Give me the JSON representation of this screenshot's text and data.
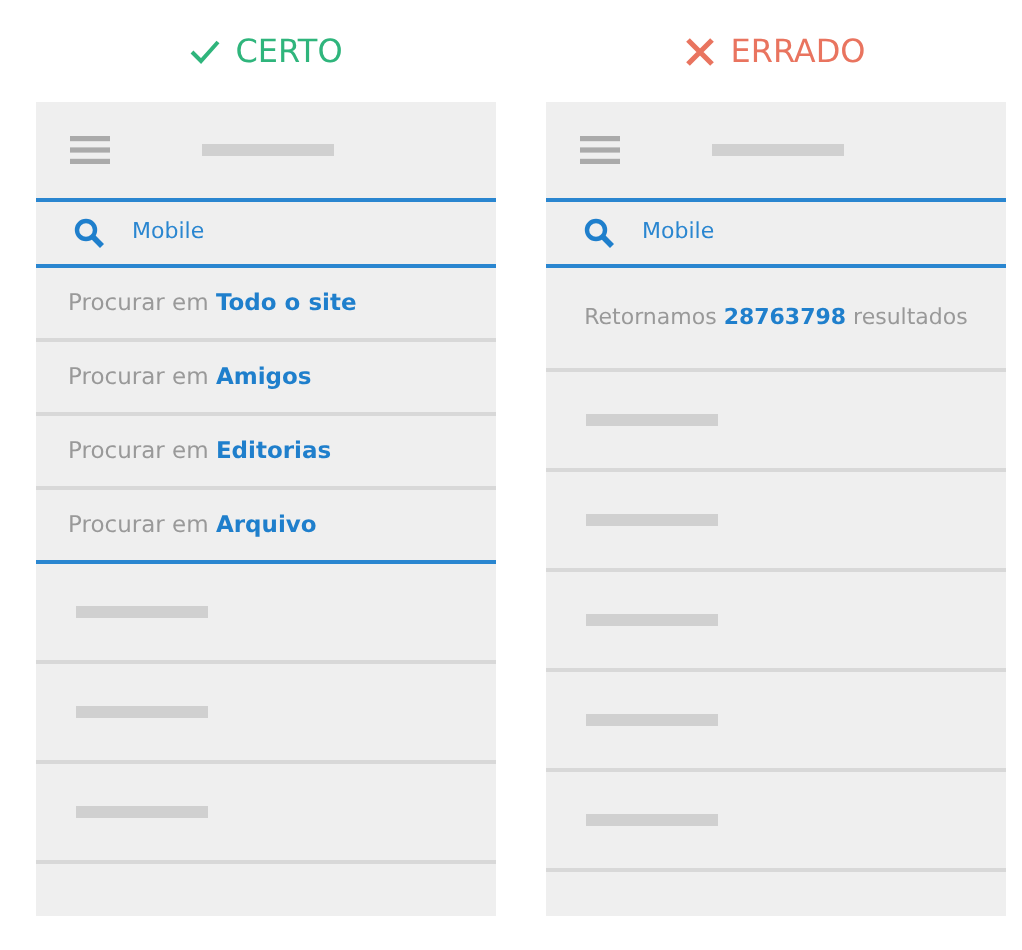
{
  "panels": [
    {
      "verdict": {
        "kind": "correct",
        "label": "CERTO"
      },
      "search": {
        "value": "Mobile"
      },
      "rows": [
        {
          "kind": "suggestion",
          "text": "Procurar em **Todo o site**"
        },
        {
          "kind": "suggestion",
          "text": "Procurar em **Amigos**"
        },
        {
          "kind": "suggestion",
          "text": "Procurar em **Editorias**"
        },
        {
          "kind": "suggestion",
          "text": "Procurar em **Arquivo**"
        },
        {
          "kind": "placeholder"
        },
        {
          "kind": "placeholder"
        },
        {
          "kind": "placeholder"
        },
        {
          "kind": "blank"
        }
      ]
    },
    {
      "verdict": {
        "kind": "wrong",
        "label": "ERRADO"
      },
      "search": {
        "value": "Mobile"
      },
      "rows": [
        {
          "kind": "result_count",
          "text": "Retornamos **28763798** resultados"
        },
        {
          "kind": "placeholder"
        },
        {
          "kind": "placeholder"
        },
        {
          "kind": "placeholder"
        },
        {
          "kind": "placeholder"
        },
        {
          "kind": "placeholder"
        },
        {
          "kind": "blank"
        }
      ]
    }
  ]
}
